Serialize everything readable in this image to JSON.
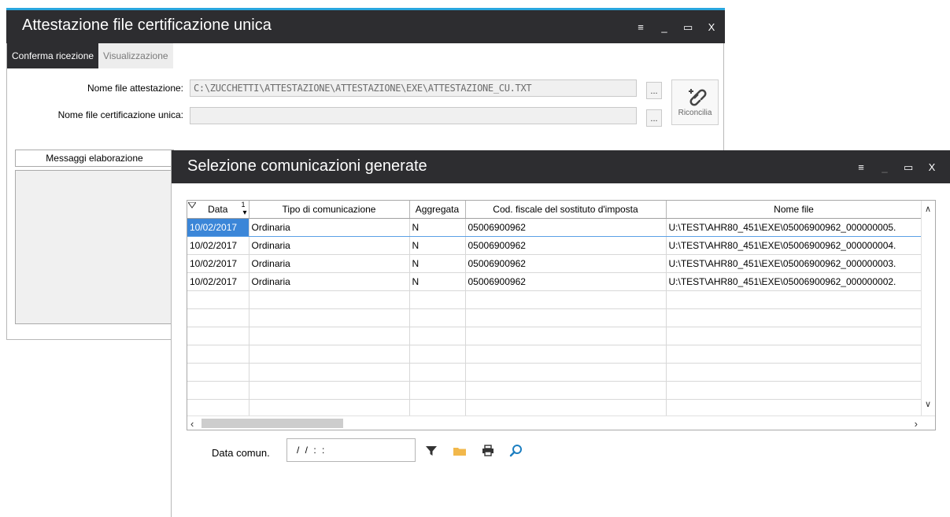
{
  "window1": {
    "title": "Attestazione file certificazione unica",
    "controls": [
      "≡",
      "_",
      "▭",
      "X"
    ],
    "tabs": [
      {
        "label": "Conferma ricezione",
        "active": true
      },
      {
        "label": "Visualizzazione",
        "active": false
      }
    ],
    "fields": {
      "attestazione_label": "Nome file attestazione:",
      "attestazione_value": "C:\\ZUCCHETTI\\ATTESTAZIONE\\ATTESTAZIONE\\EXE\\ATTESTAZIONE_CU.TXT",
      "certificazione_label": "Nome file certificazione unica:",
      "certificazione_value": "",
      "browse_label": "..."
    },
    "riconcilia_label": "Riconcilia",
    "messaggi_label": "Messaggi elaborazione",
    "accent_color": "#29a6de"
  },
  "window2": {
    "title": "Selezione comunicazioni generate",
    "controls": [
      "≡",
      "_",
      "▭",
      "X"
    ],
    "table": {
      "columns": [
        "Data",
        "Tipo di comunicazione",
        "Aggregata",
        "Cod. fiscale del sostituto d'imposta",
        "Nome file"
      ],
      "sort_indicator": "1",
      "rows": [
        [
          "10/02/2017",
          "Ordinaria",
          "N",
          "05006900962",
          "U:\\TEST\\AHR80_451\\EXE\\05006900962_000000005."
        ],
        [
          "10/02/2017",
          "Ordinaria",
          "N",
          "05006900962",
          "U:\\TEST\\AHR80_451\\EXE\\05006900962_000000004."
        ],
        [
          "10/02/2017",
          "Ordinaria",
          "N",
          "05006900962",
          "U:\\TEST\\AHR80_451\\EXE\\05006900962_000000003."
        ],
        [
          "10/02/2017",
          "Ordinaria",
          "N",
          "05006900962",
          "U:\\TEST\\AHR80_451\\EXE\\05006900962_000000002."
        ]
      ],
      "selection_color": "#3b86d8"
    },
    "filter": {
      "label": "Data comun.",
      "value": " / /    : :"
    },
    "toolbar": [
      "filter-icon",
      "folder-icon",
      "print-icon",
      "search-icon"
    ]
  }
}
